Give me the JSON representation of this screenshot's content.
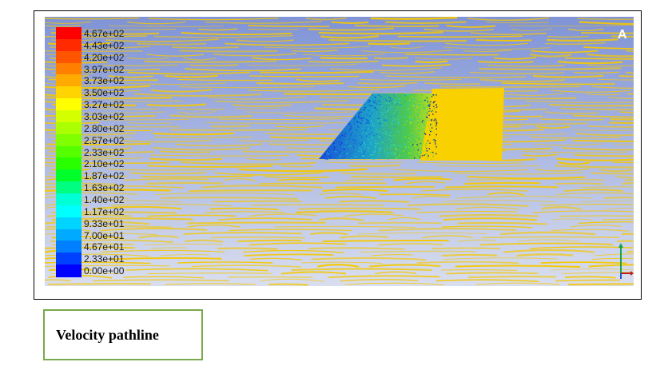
{
  "figure": {
    "caption": "Velocity pathline",
    "edge_letter": "A",
    "background_colors": {
      "top": "#7f93d6",
      "bottom": "#d9deee"
    },
    "pathline_color": "#f5c800"
  },
  "legend": {
    "labels": [
      "4.67e+02",
      "4.43e+02",
      "4.20e+02",
      "3.97e+02",
      "3.73e+02",
      "3.50e+02",
      "3.27e+02",
      "3.03e+02",
      "2.80e+02",
      "2.57e+02",
      "2.33e+02",
      "2.10e+02",
      "1.87e+02",
      "1.63e+02",
      "1.40e+02",
      "1.17e+02",
      "9.33e+01",
      "7.00e+01",
      "4.67e+01",
      "2.33e+01",
      "0.00e+00"
    ],
    "colors": [
      "#ff0000",
      "#ff2a00",
      "#ff5500",
      "#ff8000",
      "#ffaa00",
      "#ffd400",
      "#ffff00",
      "#d4ff00",
      "#aaff00",
      "#80ff00",
      "#55ff00",
      "#2aff00",
      "#00ff2a",
      "#00ff80",
      "#00ffd4",
      "#00ffff",
      "#00d4ff",
      "#00aaff",
      "#0080ff",
      "#0040ff",
      "#0000ff"
    ]
  },
  "chart_data": {
    "type": "pathline",
    "colorbar_min": 0,
    "colorbar_max": 467,
    "colorbar_ticks": [
      467,
      443,
      420,
      397,
      373,
      350,
      327,
      303,
      280,
      257,
      233,
      210,
      187,
      163,
      140,
      117,
      93.3,
      70,
      46.7,
      23.3,
      0
    ],
    "freestream_value": 350,
    "wake_color_range": [
      23.3,
      327
    ]
  }
}
